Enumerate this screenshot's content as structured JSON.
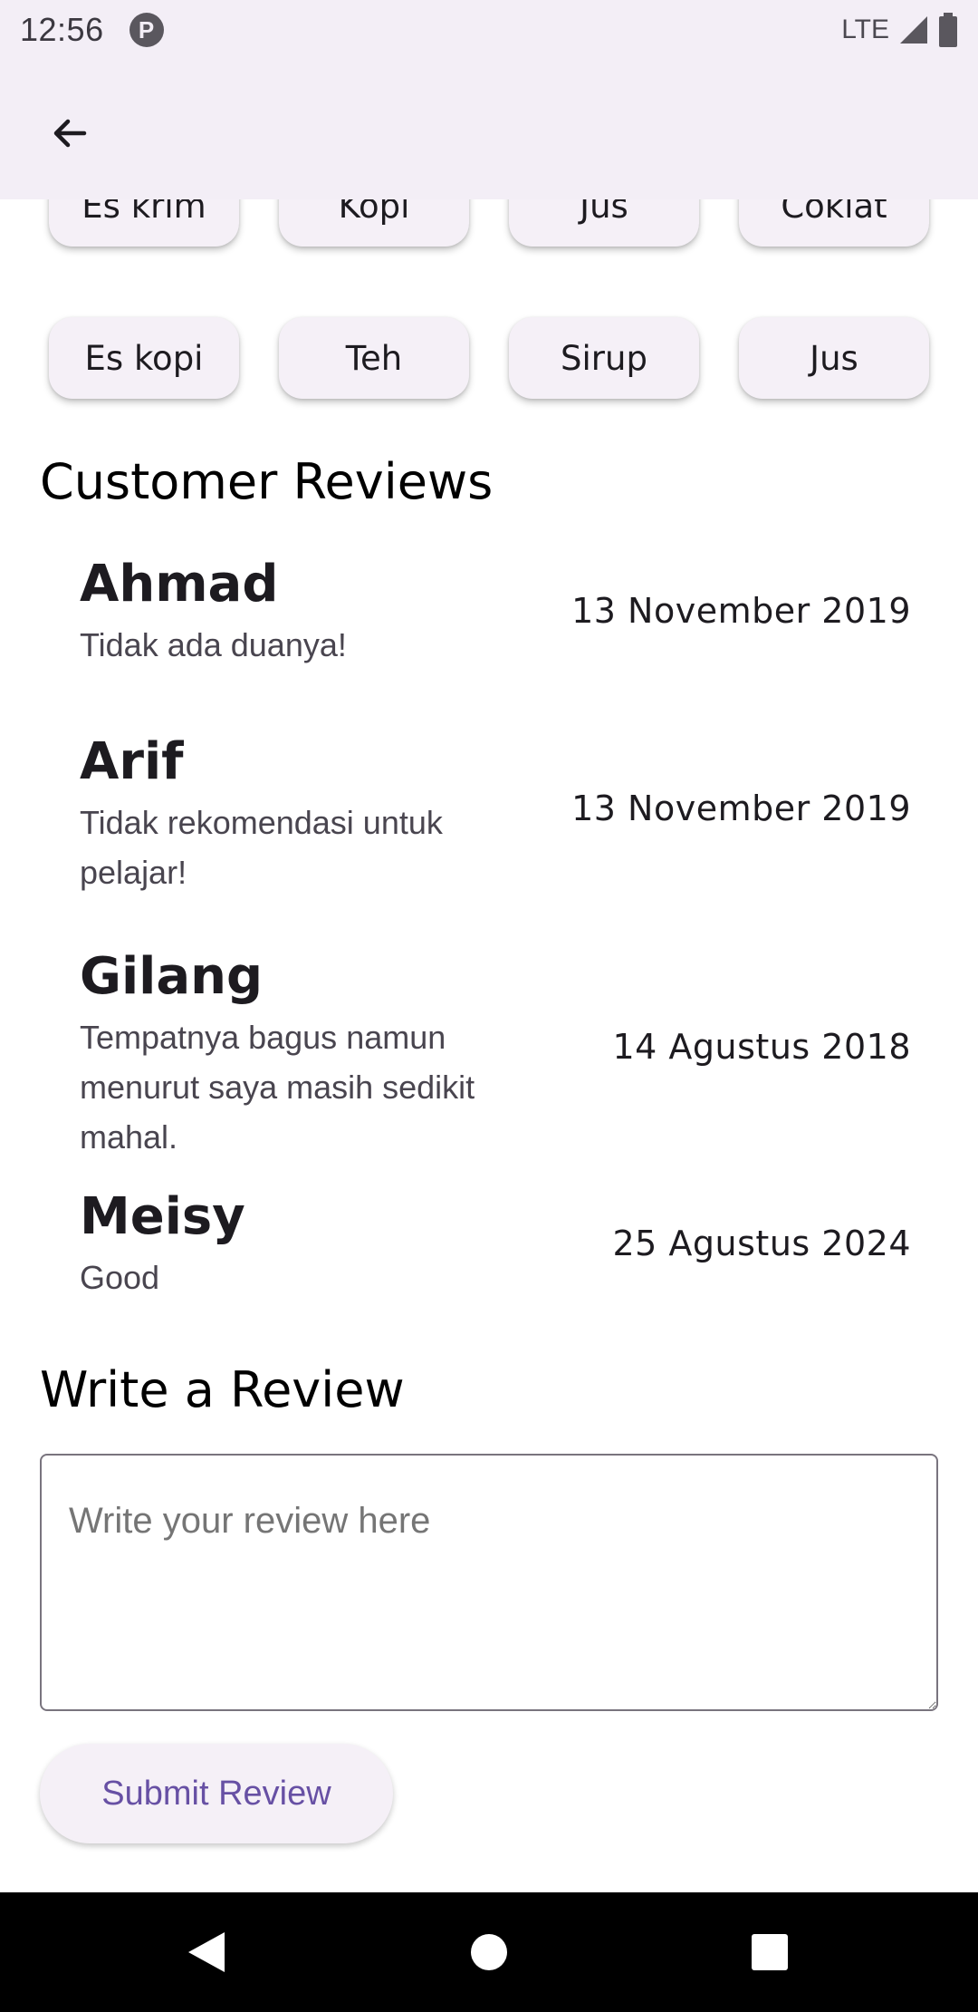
{
  "status_bar": {
    "time": "12:56",
    "app_icon_letter": "P",
    "network": "LTE"
  },
  "app_bar": {
    "back_icon": "arrow-left-icon"
  },
  "chips": {
    "row1": [
      "Es krim",
      "Kopi",
      "Jus",
      "Coklat"
    ],
    "row2": [
      "Es kopi",
      "Teh",
      "Sirup",
      "Jus"
    ]
  },
  "reviews_section": {
    "title": "Customer Reviews",
    "items": [
      {
        "name": "Ahmad",
        "text": "Tidak ada duanya!",
        "date": "13 November 2019"
      },
      {
        "name": "Arif",
        "text": "Tidak rekomendasi untuk pelajar!",
        "date": "13 November 2019"
      },
      {
        "name": "Gilang",
        "text": "Tempatnya bagus namun menurut saya masih sedikit mahal.",
        "date": "14 Agustus 2018"
      },
      {
        "name": "Meisy",
        "text": "Good",
        "date": "25 Agustus 2024"
      }
    ]
  },
  "write_review": {
    "title": "Write a Review",
    "placeholder": "Write your review here",
    "submit_label": "Submit Review"
  },
  "colors": {
    "app_bar_bg": "#f3eef6",
    "accent": "#6750a4",
    "chip_bg": "#f5f0f7"
  }
}
